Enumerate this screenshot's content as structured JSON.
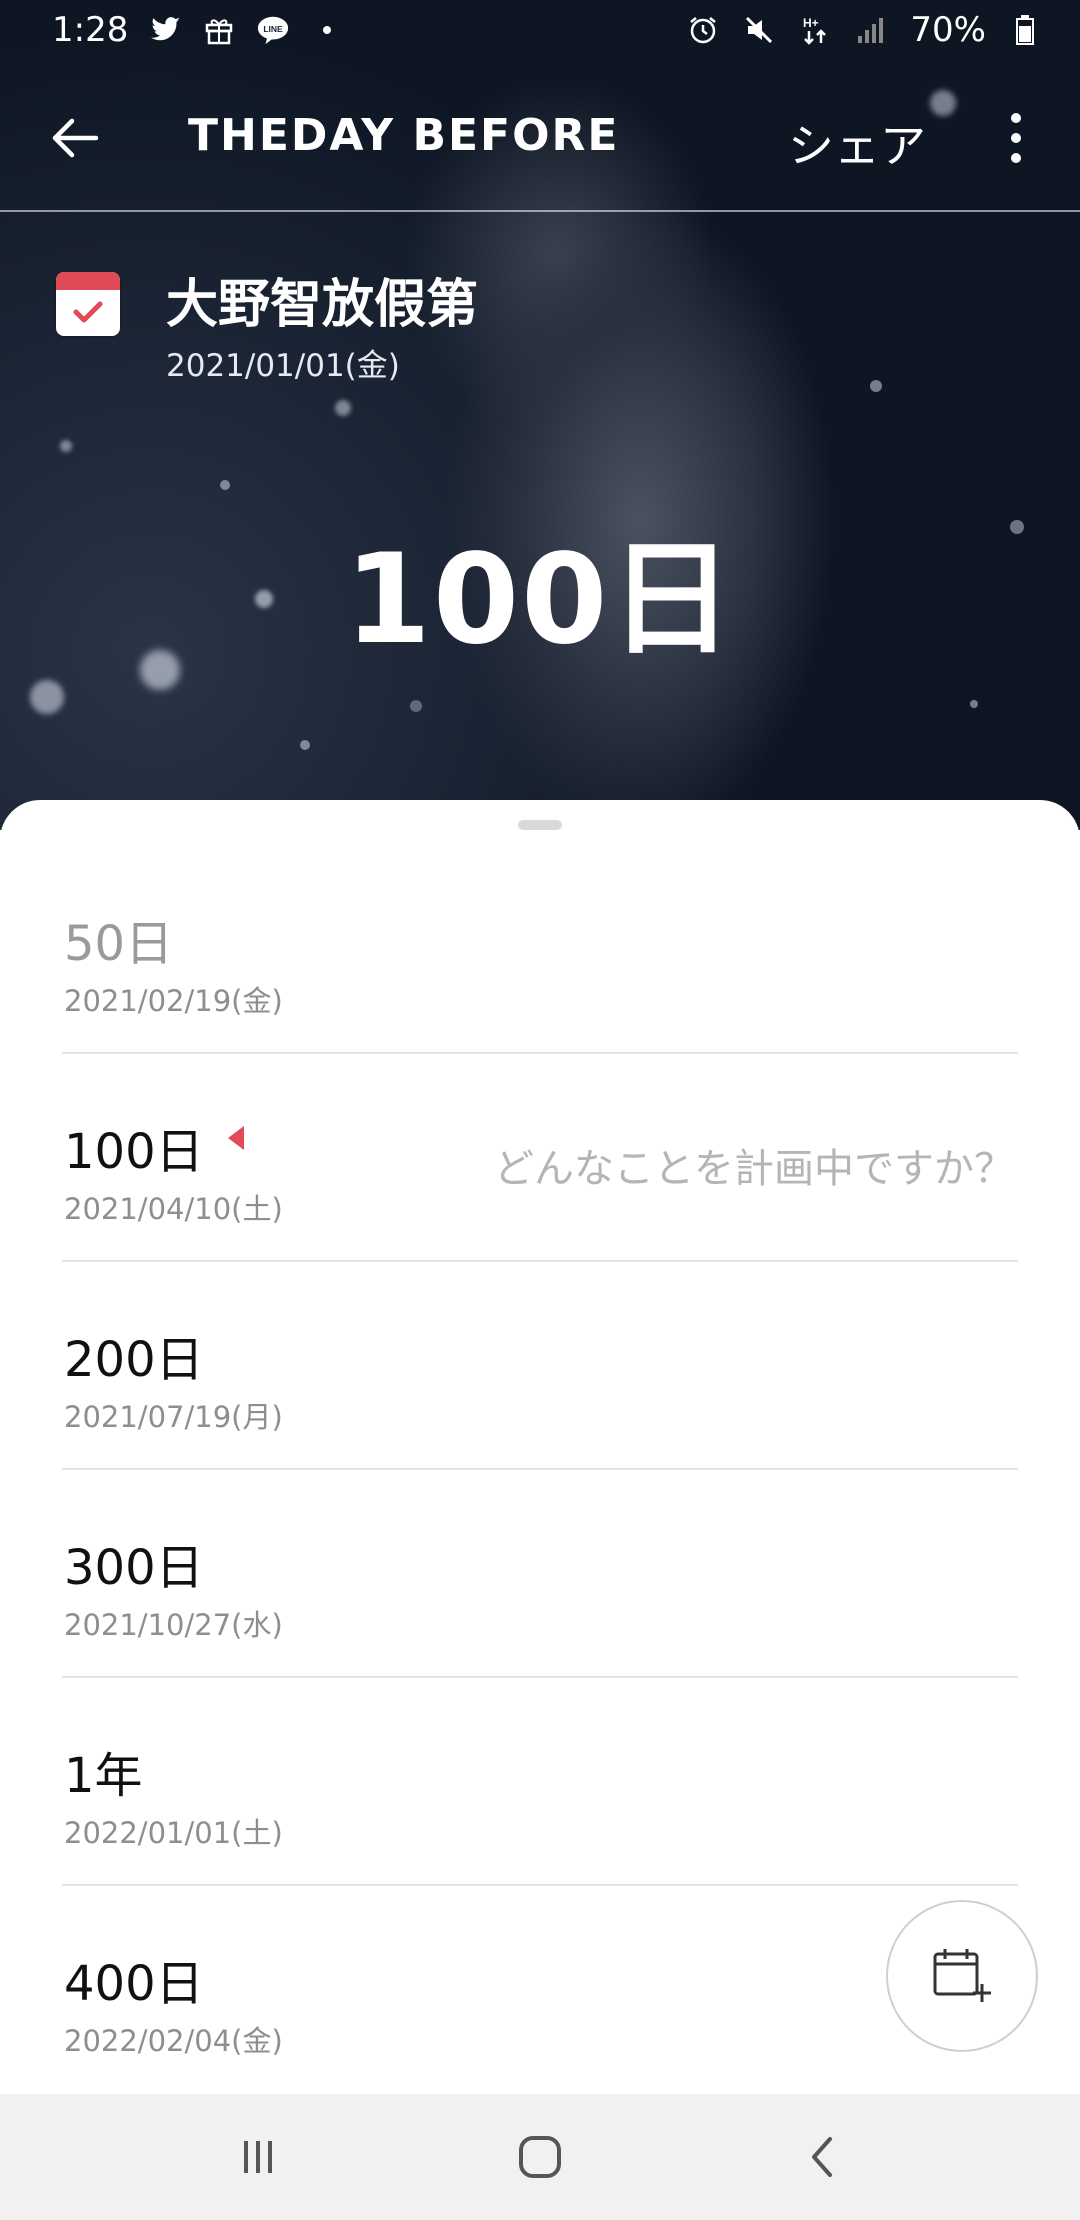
{
  "status_bar": {
    "time": "1:28",
    "battery": "70%",
    "left_icons": [
      "twitter-icon",
      "gift-icon",
      "line-icon",
      "dot-icon"
    ],
    "right_icons": [
      "alarm-icon",
      "mute-icon",
      "data-icon",
      "signal-icon",
      "battery-icon"
    ]
  },
  "app_bar": {
    "title": "THEDAY BEFORE",
    "share_label": "シェア"
  },
  "event": {
    "title": "大野智放假第",
    "date": "2021/01/01(金)",
    "count": "100日"
  },
  "milestones": [
    {
      "label": "50日",
      "date": "2021/02/19(金)",
      "past": true
    },
    {
      "label": "100日",
      "date": "2021/04/10(土)",
      "current": true,
      "hint": "どんなことを計画中ですか？"
    },
    {
      "label": "200日",
      "date": "2021/07/19(月)"
    },
    {
      "label": "300日",
      "date": "2021/10/27(水)"
    },
    {
      "label": "1年",
      "date": "2022/01/01(土)"
    },
    {
      "label": "400日",
      "date": "2022/02/04(金)"
    }
  ],
  "colors": {
    "accent": "#e24a57",
    "past_text": "#9a9a9a",
    "hint_text": "#b5b5b5"
  },
  "fab_icon": "calendar-add-icon",
  "nav": [
    "recent-apps-icon",
    "home-icon",
    "back-icon"
  ]
}
